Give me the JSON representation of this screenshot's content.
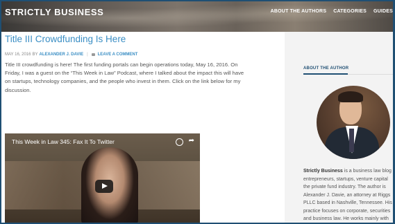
{
  "header": {
    "site_title": "STRICTLY BUSINESS",
    "nav": [
      "ABOUT THE AUTHORS",
      "CATEGORIES",
      "GUIDES"
    ]
  },
  "post": {
    "title": "Title III Crowdfunding Is Here",
    "meta": {
      "date": "MAY 16, 2016",
      "by": "BY",
      "author": "ALEXANDER J. DAVIE",
      "separator": "|",
      "comment_link": "LEAVE A COMMENT"
    },
    "body": "Title III crowdfunding is here! The first funding portals can begin operations today, May 16, 2016. On Friday, I was a guest on the “This Week in Law” Podcast, where I talked about the impact this will have on startups, technology companies, and the people who invest in them. Click on the link below for my discussion.",
    "video": {
      "title": "This Week in Law 345: Fax It To Twitter"
    }
  },
  "sidebar": {
    "heading": "ABOUT THE AUTHOR",
    "bio_name": "Strictly Business",
    "bio_lines": [
      " is a business law blog",
      "entrepreneurs, startups, venture capital",
      "the private fund industry. The author is",
      "Alexander J. Davie, an attorney at Riggs",
      "PLLC based in Nashville, Tennessee. His",
      "practice focuses on corporate, securities",
      "and business law. He works mainly with"
    ]
  },
  "colors": {
    "accent": "#3a8ec4",
    "frame": "#1f4f73",
    "sidebar_bg": "#f3f3f3"
  }
}
